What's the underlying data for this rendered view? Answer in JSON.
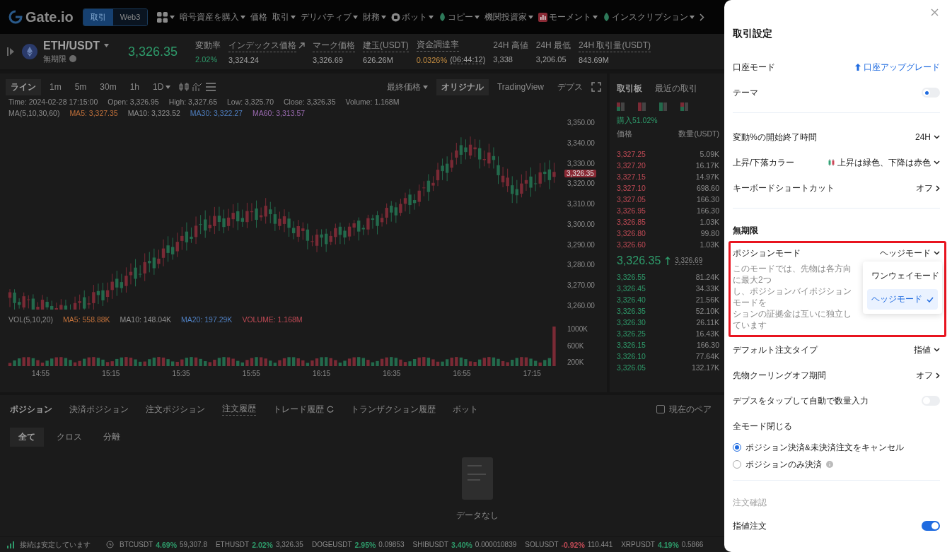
{
  "nav": {
    "logo": "Gate.io",
    "mode_tabs": [
      {
        "label": "取引",
        "selected": true
      },
      {
        "label": "Web3",
        "selected": false
      }
    ],
    "items": [
      {
        "label": "暗号資産を購入",
        "menu": true,
        "kind": "plain"
      },
      {
        "label": "価格",
        "menu": false,
        "kind": "plain"
      },
      {
        "label": "取引",
        "menu": true,
        "kind": "plain"
      },
      {
        "label": "デリバティブ",
        "menu": true,
        "kind": "plain"
      },
      {
        "label": "財務",
        "menu": true,
        "kind": "plain"
      },
      {
        "label": "ボット",
        "menu": true,
        "kind": "bot"
      },
      {
        "label": "コピー",
        "menu": true,
        "kind": "leaf"
      },
      {
        "label": "機関投資家",
        "menu": true,
        "kind": "plain"
      },
      {
        "label": "モーメント",
        "menu": true,
        "kind": "bars"
      },
      {
        "label": "インスクリプション",
        "menu": true,
        "kind": "leaf"
      }
    ]
  },
  "ticker": {
    "pair": "ETH/USDT",
    "market": "無期限",
    "price": "3,326.35",
    "stats": [
      {
        "label": "変動率",
        "value": "2.02%",
        "kind": "change",
        "dashed": false
      },
      {
        "label": "インデックス価格",
        "value": "3,324.24",
        "kind": "plain",
        "dashed": true,
        "link": true
      },
      {
        "label": "マーク価格",
        "value": "3,326.69",
        "kind": "plain",
        "dashed": true
      },
      {
        "label": "建玉(USDT)",
        "value": "626.26M",
        "kind": "plain",
        "dashed": true
      },
      {
        "label": "資金調達率",
        "value": "0.0326%",
        "kind": "funding",
        "dashed": true,
        "countdown": "(06:44:12)"
      },
      {
        "label": "24H 高値",
        "value": "3,338",
        "kind": "plain",
        "dashed": false
      },
      {
        "label": "24H 最低",
        "value": "3,206.05",
        "kind": "plain",
        "dashed": false
      },
      {
        "label": "24H 取引量(USDT)",
        "value": "843.69M",
        "kind": "plain",
        "dashed": true
      }
    ]
  },
  "chart": {
    "intervals": [
      {
        "label": "ライン",
        "selected": true,
        "menu": false
      },
      {
        "label": "1m",
        "selected": false,
        "menu": false
      },
      {
        "label": "5m",
        "selected": false,
        "menu": false
      },
      {
        "label": "30m",
        "selected": false,
        "menu": false
      },
      {
        "label": "1h",
        "selected": false,
        "menu": false
      },
      {
        "label": "1D",
        "selected": false,
        "menu": true
      }
    ],
    "price_source": "最終価格",
    "views": [
      {
        "label": "オリジナル",
        "selected": true
      },
      {
        "label": "TradingView",
        "selected": false
      },
      {
        "label": "デプス",
        "selected": false
      }
    ],
    "ohlc": [
      "Time: 2024-02-28 17:15:00",
      "Open: 3,326.95",
      "High: 3,327.65",
      "Low: 3,325.70",
      "Close: 3,326.35",
      "Volume: 1.168M"
    ],
    "ma_title": "MA(5,10,30,60)",
    "ma": [
      {
        "label": "MA5: 3,327.35",
        "color": "#c0703a"
      },
      {
        "label": "MA10: 3,323.52",
        "color": "#8f8f8f"
      },
      {
        "label": "MA30: 3,322.27",
        "color": "#4f7fc0"
      },
      {
        "label": "MA60: 3,313.57",
        "color": "#9a6ab0"
      }
    ],
    "price_axis": [
      "3,350.00",
      "3,340.00",
      "3,330.00",
      "3,320.00",
      "3,310.00",
      "3,300.00",
      "3,290.00",
      "3,280.00",
      "3,270.00",
      "3,260.00"
    ],
    "last_price_tag": "3,326.35",
    "volume_title": "VOL(5,10,20)",
    "volume_ma": [
      {
        "label": "MA5: 558.88K",
        "color": "#c0703a"
      },
      {
        "label": "MA10: 148.04K",
        "color": "#8f8f8f"
      },
      {
        "label": "MA20: 197.29K",
        "color": "#4f7fc0"
      },
      {
        "label": "VOLUME: 1.168M",
        "color": "#c04a55"
      }
    ],
    "volume_axis": [
      "1000K",
      "600K",
      "200K"
    ],
    "time_axis": [
      "14:55",
      "15:15",
      "15:35",
      "15:55",
      "16:15",
      "16:35",
      "16:55",
      "17:15"
    ]
  },
  "orderbook": {
    "tabs": [
      {
        "label": "取引板",
        "selected": true
      },
      {
        "label": "最近の取引",
        "selected": false
      }
    ],
    "buy_ratio": "購入51.02%",
    "columns": [
      "価格",
      "数量(USDT)"
    ],
    "asks": [
      {
        "price": "3,327.25",
        "amount": "5.09K"
      },
      {
        "price": "3,327.20",
        "amount": "16.17K"
      },
      {
        "price": "3,327.15",
        "amount": "14.97K"
      },
      {
        "price": "3,327.10",
        "amount": "698.60"
      },
      {
        "price": "3,327.05",
        "amount": "166.30"
      },
      {
        "price": "3,326.95",
        "amount": "166.30"
      },
      {
        "price": "3,326.85",
        "amount": "1.03K"
      },
      {
        "price": "3,326.80",
        "amount": "99.80"
      },
      {
        "price": "3,326.60",
        "amount": "1.03K"
      }
    ],
    "last_price": "3,326.35",
    "mark_price": "3,326.69",
    "bids": [
      {
        "price": "3,326.55",
        "amount": "81.24K"
      },
      {
        "price": "3,326.45",
        "amount": "34.33K"
      },
      {
        "price": "3,326.40",
        "amount": "21.56K"
      },
      {
        "price": "3,326.35",
        "amount": "52.10K"
      },
      {
        "price": "3,326.30",
        "amount": "26.11K"
      },
      {
        "price": "3,326.25",
        "amount": "16.43K"
      },
      {
        "price": "3,326.15",
        "amount": "166.30"
      },
      {
        "price": "3,326.10",
        "amount": "77.64K"
      },
      {
        "price": "3,326.05",
        "amount": "132.17K"
      }
    ]
  },
  "positions": {
    "tabs": [
      {
        "label": "ポジション",
        "selected": true,
        "dashed": false,
        "refresh": false
      },
      {
        "label": "決済ポジション",
        "selected": false,
        "dashed": false,
        "refresh": false
      },
      {
        "label": "注文ポジション",
        "selected": false,
        "dashed": false,
        "refresh": false
      },
      {
        "label": "注文履歴",
        "selected": false,
        "dashed": true,
        "refresh": false
      },
      {
        "label": "トレード履歴",
        "selected": false,
        "dashed": false,
        "refresh": true
      },
      {
        "label": "トランザクション履歴",
        "selected": false,
        "dashed": false,
        "refresh": false
      },
      {
        "label": "ボット",
        "selected": false,
        "dashed": false,
        "refresh": false
      }
    ],
    "filter": {
      "label": "現在のペア",
      "checked": false
    },
    "subtabs": [
      {
        "label": "全て",
        "selected": true
      },
      {
        "label": "クロス",
        "selected": false
      },
      {
        "label": "分離",
        "selected": false
      }
    ],
    "empty": "データなし"
  },
  "status_bar": {
    "connection": "接続は安定しています",
    "tickers": [
      {
        "symbol": "BTCUSDT",
        "change": "4.69%",
        "price": "59,307.8",
        "color": "#2e9a6a"
      },
      {
        "symbol": "ETHUSDT",
        "change": "2.02%",
        "price": "3,326.35",
        "color": "#2e9a6a"
      },
      {
        "symbol": "DOGEUSDT",
        "change": "2.95%",
        "price": "0.09853",
        "color": "#2e9a6a"
      },
      {
        "symbol": "SHIBUSDT",
        "change": "3.40%",
        "price": "0.000010839",
        "color": "#2e9a6a"
      },
      {
        "symbol": "SOLUSDT",
        "change": "-0.92%",
        "price": "110.441",
        "color": "#c04a55"
      },
      {
        "symbol": "XRPUSDT",
        "change": "4.19%",
        "price": "0.5866",
        "color": "#2e9a6a"
      }
    ]
  },
  "settings": {
    "title": "取引設定",
    "sections": [
      {
        "items": [
          {
            "kind": "link",
            "label": "口座モード",
            "value": "口座アップグレード"
          },
          {
            "kind": "theme",
            "label": "テーマ",
            "on": false
          }
        ]
      },
      {
        "items": [
          {
            "kind": "select",
            "label": "変動%の開始終了時間",
            "value": "24H"
          },
          {
            "kind": "select",
            "label": "上昇/下落カラー",
            "value": "上昇は緑色、下降は赤色",
            "swatch": true
          },
          {
            "kind": "nav",
            "label": "キーボードショートカット",
            "value": "オフ"
          }
        ]
      },
      {
        "heading": "無期限",
        "muted": false,
        "items": [
          {
            "kind": "mode",
            "label": "ポジションモード",
            "value": "ヘッジモード",
            "highlighted": true,
            "description": [
              "このモードでは、先物は各方向に最大2つ",
              "し、ポジションバイポジションモードを",
              "ションの証拠金は互いに独立しています"
            ],
            "options": [
              {
                "label": "ワンウェイモード",
                "selected": false
              },
              {
                "label": "ヘッジモード",
                "selected": true
              }
            ]
          },
          {
            "kind": "select",
            "label": "デフォルト注文タイプ",
            "value": "指値"
          },
          {
            "kind": "nav",
            "label": "先物クーリングオフ期間",
            "value": "オフ"
          },
          {
            "kind": "toggle",
            "label": "デプスをタップして自動で数量入力",
            "on": false
          },
          {
            "kind": "radio",
            "label": "全モード閉じる",
            "options": [
              {
                "label": "ポジション決済&未決済注文をキャンセル",
                "selected": true,
                "info": false
              },
              {
                "label": "ポジションのみ決済",
                "selected": false,
                "info": true
              }
            ]
          }
        ]
      },
      {
        "heading": "注文確認",
        "muted": true,
        "items": [
          {
            "kind": "toggle",
            "label": "指値注文",
            "on": true
          }
        ]
      }
    ]
  }
}
